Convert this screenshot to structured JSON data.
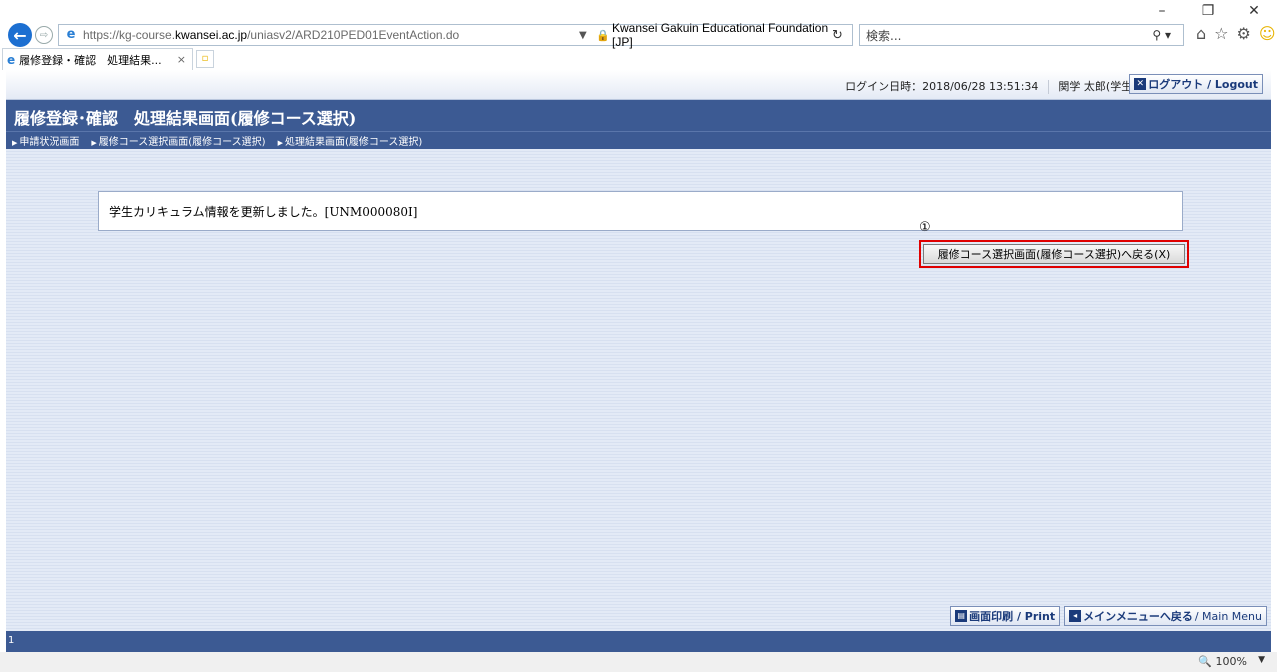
{
  "browser": {
    "window_controls": {
      "minimize": "–",
      "restore": "❐",
      "close": "✕"
    },
    "address": {
      "url_prefix": "https://kg-course.",
      "url_domain": "kwansei.ac.jp",
      "url_path": "/uniasv2/ARD210PED01EventAction.do",
      "cert_text": "Kwansei Gakuin Educational Foundation [JP]"
    },
    "search_placeholder": "検索...",
    "tab_title": "履修登録・確認　処理結果...",
    "tab_close": "×"
  },
  "header": {
    "login_info": "ログイン日時：2018/06/28 13:51:34",
    "user_name": "関学 太郎(学生)",
    "logout_label": "ログアウト / Logout",
    "page_title": "履修登録･確認　処理結果画面(履修コース選択)"
  },
  "breadcrumb": [
    {
      "label": "申請状況画面"
    },
    {
      "label": "履修コース選択画面(履修コース選択)"
    },
    {
      "label": "処理結果画面(履修コース選択)"
    }
  ],
  "main": {
    "message": "学生カリキュラム情報を更新しました。[UNM000080I]",
    "annotation_number": "①",
    "return_button_label": "履修コース選択画面(履修コース選択)へ戻る(X)"
  },
  "footer": {
    "print_label": "画面印刷 / Print",
    "main_menu_label_jp": "メインメニューへ戻る",
    "main_menu_label_en": "/ Main Menu",
    "page_number": "1"
  },
  "statusbar": {
    "zoom": "100%"
  },
  "colors": {
    "title_bar": "#3c5a93",
    "highlight": "#e00000",
    "browser_accent": "#1c6fd1"
  }
}
